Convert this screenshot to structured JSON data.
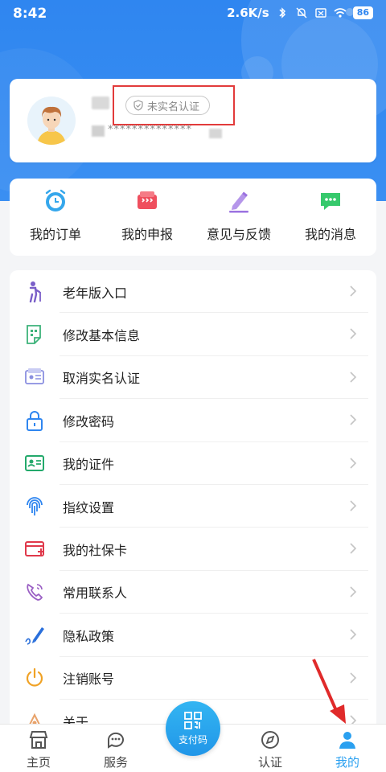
{
  "status_bar": {
    "time": "8:42",
    "network_speed": "2.6K/s",
    "battery": "86",
    "icons": [
      "bluetooth-icon",
      "mute-icon",
      "sim-icon",
      "wifi-icon"
    ]
  },
  "profile": {
    "avatar_icon": "user-avatar-illustration",
    "verify_status": "未实名认证",
    "id_masked": "**************"
  },
  "quick_actions": [
    {
      "label": "我的订单",
      "icon": "clock-icon",
      "color": "#35a7ec"
    },
    {
      "label": "我的申报",
      "icon": "declare-icon",
      "color": "#ef4f5e"
    },
    {
      "label": "意见与反馈",
      "icon": "pencil-icon",
      "color": "#9b72e0"
    },
    {
      "label": "我的消息",
      "icon": "chat-icon",
      "color": "#36c96c"
    }
  ],
  "menu": [
    {
      "label": "老年版入口",
      "icon": "elderly-icon"
    },
    {
      "label": "修改基本信息",
      "icon": "edit-info-icon"
    },
    {
      "label": "取消实名认证",
      "icon": "id-card-icon"
    },
    {
      "label": "修改密码",
      "icon": "lock-icon"
    },
    {
      "label": "我的证件",
      "icon": "certificate-icon"
    },
    {
      "label": "指纹设置",
      "icon": "fingerprint-icon"
    },
    {
      "label": "我的社保卡",
      "icon": "social-card-icon"
    },
    {
      "label": "常用联系人",
      "icon": "phone-icon"
    },
    {
      "label": "隐私政策",
      "icon": "privacy-pen-icon"
    },
    {
      "label": "注销账号",
      "icon": "power-icon"
    },
    {
      "label": "关于",
      "icon": "about-icon"
    }
  ],
  "tabbar": {
    "tabs": [
      {
        "label": "主页",
        "icon": "home-icon"
      },
      {
        "label": "服务",
        "icon": "service-icon"
      },
      {
        "label": "认证",
        "icon": "compass-icon"
      },
      {
        "label": "我的",
        "icon": "user-icon",
        "active": true
      }
    ],
    "pay_label": "支付码",
    "active_color": "#2aa0f0"
  }
}
